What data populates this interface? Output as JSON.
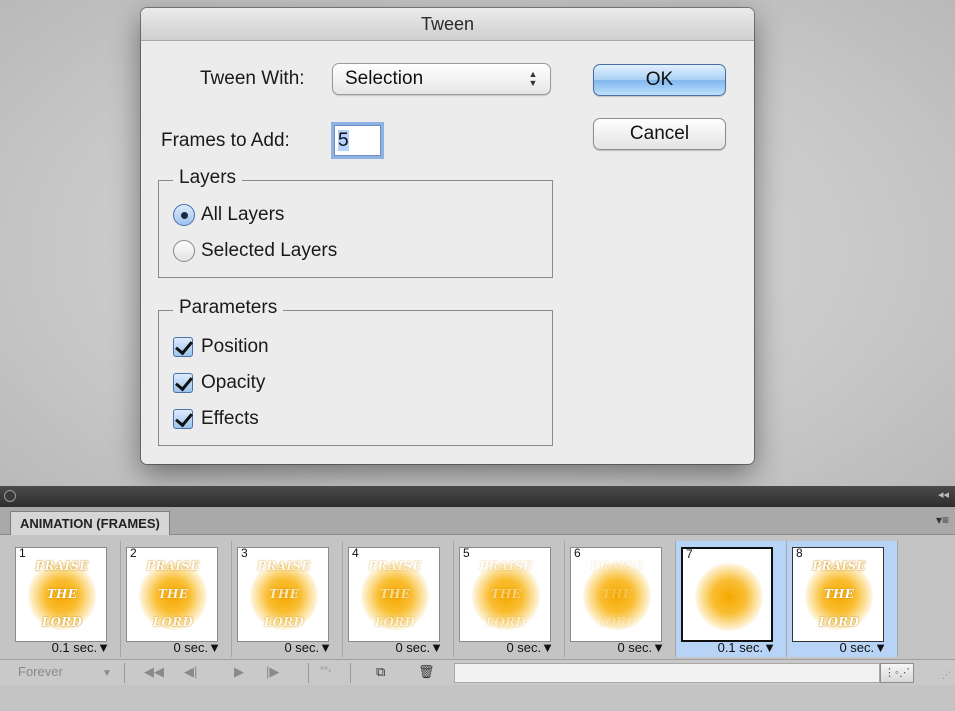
{
  "dialog": {
    "title": "Tween",
    "tween_with_label": "Tween With:",
    "tween_with_value": "Selection",
    "frames_to_add_label": "Frames to Add:",
    "frames_to_add_value": "5",
    "ok_label": "OK",
    "cancel_label": "Cancel",
    "layers": {
      "legend": "Layers",
      "options": [
        {
          "label": "All Layers",
          "selected": true
        },
        {
          "label": "Selected Layers",
          "selected": false
        }
      ]
    },
    "parameters": {
      "legend": "Parameters",
      "options": [
        {
          "label": "Position",
          "checked": true
        },
        {
          "label": "Opacity",
          "checked": true
        },
        {
          "label": "Effects",
          "checked": true
        }
      ]
    }
  },
  "panel": {
    "tab_label": "ANIMATION (FRAMES)",
    "frames": [
      {
        "num": "1",
        "delay": "0.1 sec.▼",
        "text": [
          "PRAISE",
          "THE",
          "LORD"
        ],
        "text_opacity": 1.0,
        "selected": false
      },
      {
        "num": "2",
        "delay": "0 sec.▼",
        "text": [
          "PRAISE",
          "THE",
          "LORD"
        ],
        "text_opacity": 0.85,
        "selected": false
      },
      {
        "num": "3",
        "delay": "0 sec.▼",
        "text": [
          "PRAISE",
          "THE",
          "LORD"
        ],
        "text_opacity": 0.7,
        "selected": false
      },
      {
        "num": "4",
        "delay": "0 sec.▼",
        "text": [
          "PRAISE",
          "THE",
          "LORD"
        ],
        "text_opacity": 0.55,
        "selected": false
      },
      {
        "num": "5",
        "delay": "0 sec.▼",
        "text": [
          "PRAISE",
          "THE",
          "LORD"
        ],
        "text_opacity": 0.4,
        "selected": false
      },
      {
        "num": "6",
        "delay": "0 sec.▼",
        "text": [
          "PRAISE",
          "THE",
          "LORD"
        ],
        "text_opacity": 0.2,
        "selected": false
      },
      {
        "num": "7",
        "delay": "0.1 sec.▼",
        "text": [
          "",
          "",
          ""
        ],
        "text_opacity": 0,
        "selected": true,
        "active": true
      },
      {
        "num": "8",
        "delay": "0 sec.▼",
        "text": [
          "PRAISE",
          "THE",
          "LORD"
        ],
        "text_opacity": 1.0,
        "selected": true
      }
    ],
    "loop_label": "Forever",
    "colors": {
      "selection": "#b7d3f6",
      "glow": "#f6a800"
    }
  }
}
